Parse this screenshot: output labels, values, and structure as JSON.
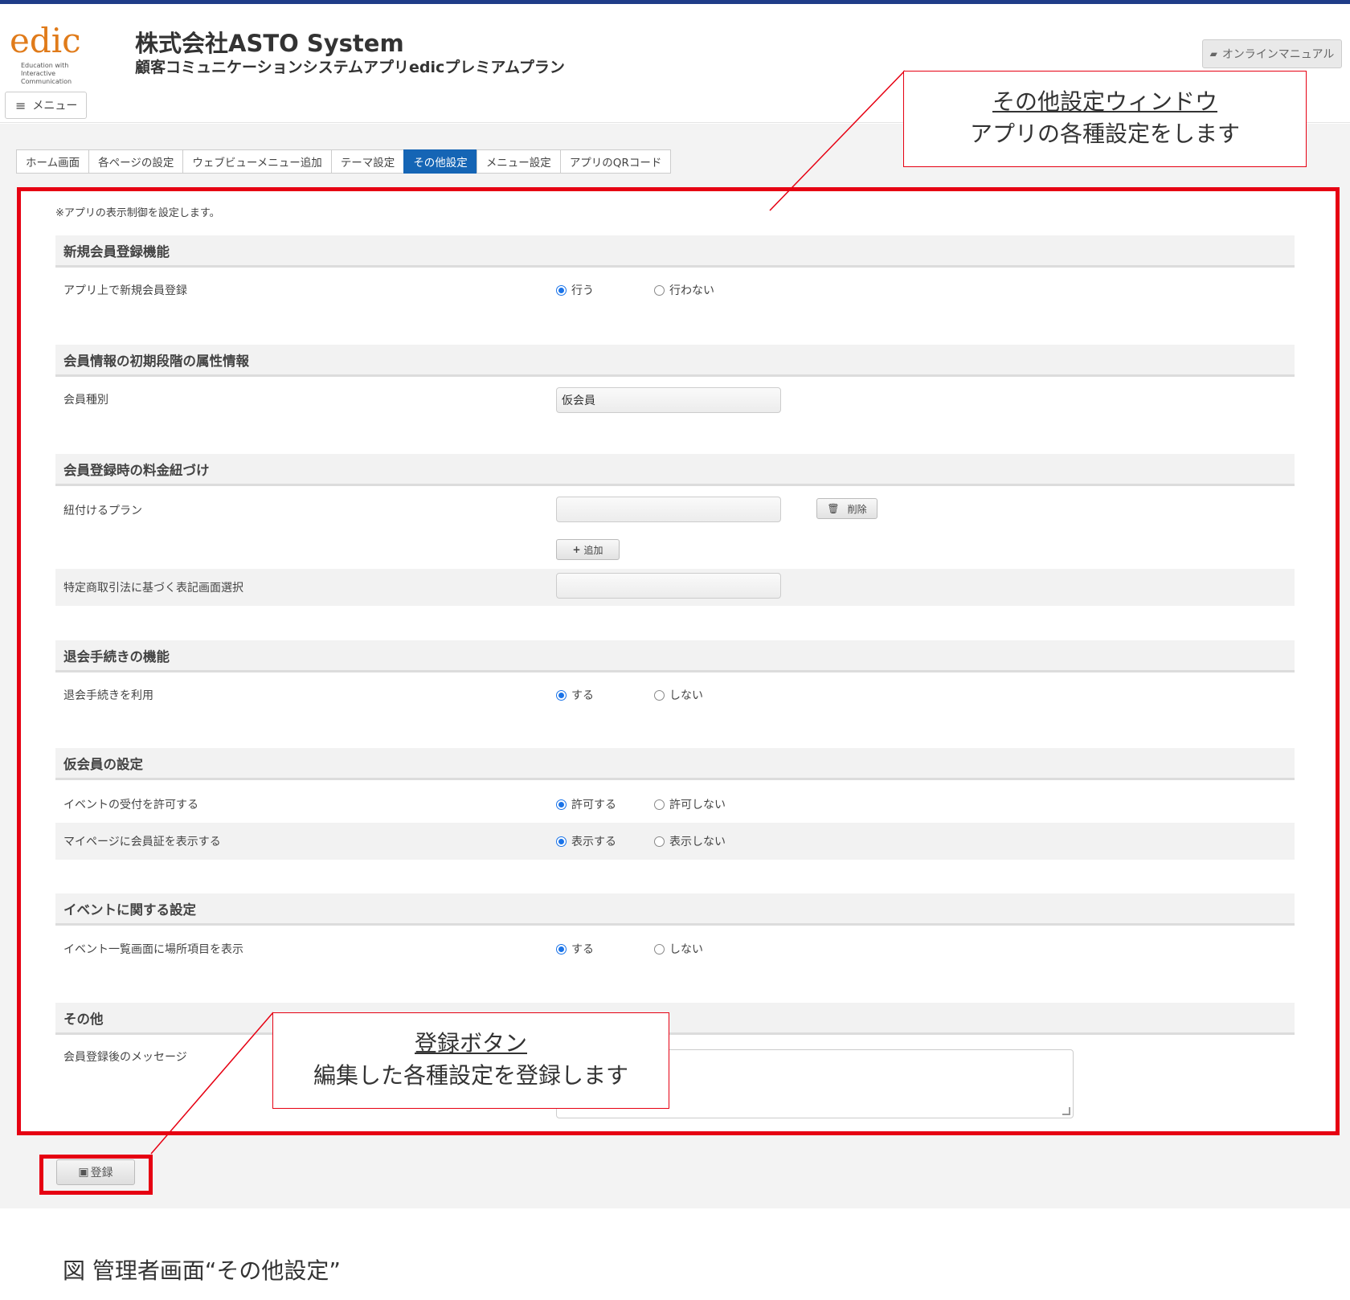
{
  "header": {
    "logo": "edic",
    "logo_sub": [
      "Education with",
      "Interactive",
      "Communication"
    ],
    "company": "株式会社ASTO System",
    "product": "顧客コミュニケーションシステムアプリedicプレミアムプラン",
    "menu_label": "メニュー",
    "manual_label": "オンラインマニュアル"
  },
  "tabs": [
    "ホーム画面",
    "各ページの設定",
    "ウェブビューメニュー追加",
    "テーマ設定",
    "その他設定",
    "メニュー設定",
    "アプリのQRコード"
  ],
  "active_tab": "その他設定",
  "note": "※アプリの表示制御を設定します。",
  "sections": {
    "s1": {
      "title": "新規会員登録機能",
      "row_label": "アプリ上で新規会員登録",
      "opt_on": "行う",
      "opt_off": "行わない"
    },
    "s2": {
      "title": "会員情報の初期段階の属性情報",
      "row_label": "会員種別",
      "value": "仮会員"
    },
    "s3": {
      "title": "会員登録時の料金紐づけ",
      "row_label": "紐付けるプラン",
      "delete_label": "削除",
      "add_label": "追加",
      "row2_label": "特定商取引法に基づく表記画面選択"
    },
    "s4": {
      "title": "退会手続きの機能",
      "row_label": "退会手続きを利用",
      "opt_on": "する",
      "opt_off": "しない"
    },
    "s5": {
      "title": "仮会員の設定",
      "row1_label": "イベントの受付を許可する",
      "row1_on": "許可する",
      "row1_off": "許可しない",
      "row2_label": "マイページに会員証を表示する",
      "row2_on": "表示する",
      "row2_off": "表示しない"
    },
    "s6": {
      "title": "イベントに関する設定",
      "row_label": "イベント一覧画面に場所項目を表示",
      "opt_on": "する",
      "opt_off": "しない"
    },
    "s7": {
      "title": "その他",
      "row_label": "会員登録後のメッセージ"
    }
  },
  "save_label": "登録",
  "callouts": {
    "window_title": "その他設定ウィンドウ",
    "window_desc": "アプリの各種設定をします",
    "save_title": "登録ボタン",
    "save_desc": "編集した各種設定を登録します"
  },
  "caption": "図 管理者画面“その他設定”",
  "colors": {
    "accent": "#1565b5",
    "highlight": "#e60012",
    "logo": "#e07b1a",
    "topbar": "#1f3c88"
  }
}
